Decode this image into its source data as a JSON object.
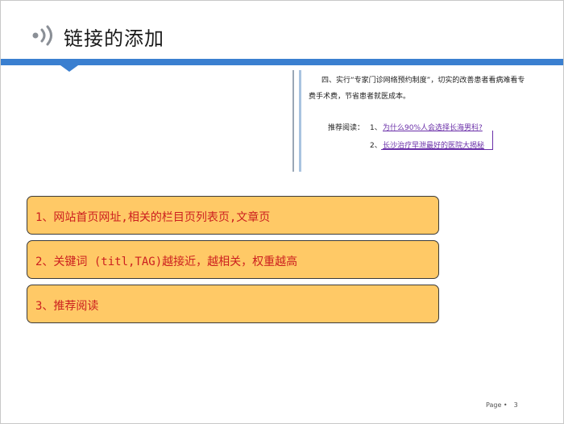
{
  "header": {
    "title": "链接的添加",
    "icon": "signal-broadcast-icon",
    "accent_color": "#3a7fd0"
  },
  "excerpt": {
    "line1": "四、实行“专家门诊网络预约制度”，切实的改善患者看病难看专",
    "line2": "费手术费，节省患者就医成本。",
    "recommend_label": "推荐阅读：",
    "links": [
      {
        "num": "1、",
        "text": "为什么90%人会选择长海男科?"
      },
      {
        "num": "2、",
        "text": "长沙治疗早泄最好的医院大揭秘"
      }
    ],
    "link_color": "#6a2fa8"
  },
  "items": [
    "1、网站首页网址,相关的栏目页列表页,文章页",
    "2、关键词 (titl,TAG)越接近，越相关，权重越高",
    "3、推荐阅读"
  ],
  "item_style": {
    "fill": "#ffc966",
    "text_color": "#cc1f1f"
  },
  "footer": {
    "page_label": "Page •",
    "page_number": "3"
  }
}
